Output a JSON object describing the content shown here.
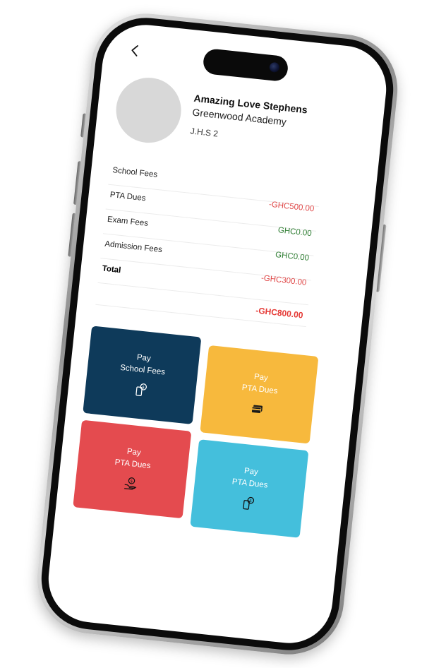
{
  "profile": {
    "name": "Amazing Love Stephens",
    "school": "Greenwood Academy",
    "class": "J.H.S 2"
  },
  "fees": {
    "rows": [
      {
        "label": "School Fees",
        "amount": "-GHC500.00",
        "status": "owing"
      },
      {
        "label": "PTA Dues",
        "amount": "GHC0.00",
        "status": "paid"
      },
      {
        "label": "Exam Fees",
        "amount": "GHC0.00",
        "status": "paid"
      },
      {
        "label": "Admission Fees",
        "amount": "-GHC300.00",
        "status": "owing"
      }
    ],
    "total_label": "Total",
    "total_amount": "-GHC800.00"
  },
  "actions": [
    {
      "line1": "Pay",
      "line2": "School Fees",
      "icon": "phone-coin-icon",
      "color": "#0e3a5a"
    },
    {
      "line1": "Pay",
      "line2": "PTA Dues",
      "icon": "credit-card-icon",
      "color": "#f7b93d"
    },
    {
      "line1": "Pay",
      "line2": "PTA Dues",
      "icon": "hand-coin-icon",
      "color": "#e44b4f"
    },
    {
      "line1": "Pay",
      "line2": "PTA Dues",
      "icon": "phone-coin-icon",
      "color": "#44bfdc"
    }
  ],
  "colors": {
    "owing": "#e04848",
    "paid": "#2e7d32",
    "total": "#e53935"
  }
}
